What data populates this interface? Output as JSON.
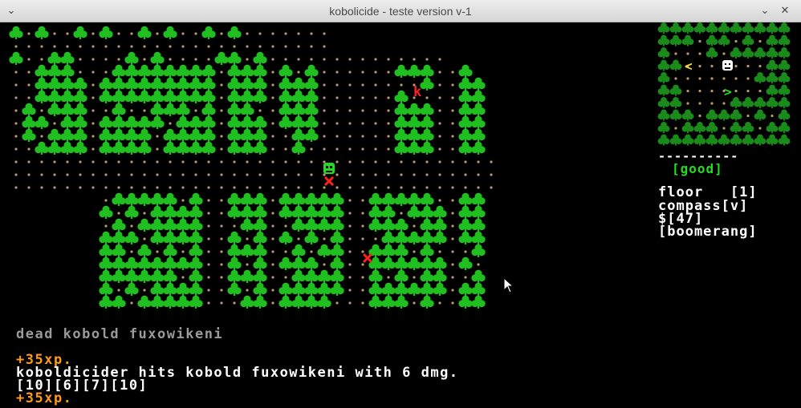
{
  "window": {
    "title": "kobolicide - teste version v-1",
    "menu_glyph": "⌄",
    "min_glyph": "⌄",
    "close_glyph": "✕"
  },
  "hud": {
    "divider": "----------",
    "status": "[good]",
    "floor": "floor   [1]",
    "compass": "compass[v]",
    "money": "$[47]",
    "weapon": "[boomerang]"
  },
  "log": {
    "line1": "dead kobold fuxowikeni",
    "line2": "+35xp.",
    "line3": "koboldicider hits kobold fuxowikeni with 6 dmg.",
    "line4": "[10][6][7][10]",
    "line5": "+35xp."
  },
  "colors": {
    "tree": "#1fbf1f",
    "dirt": "#b89a6e",
    "enemy": "#ff2020",
    "player": "#20dd20",
    "xp": "#ff9a1a",
    "minimap_tree": "#1a8a1a"
  },
  "icons": [
    "menu-icon",
    "minimize-icon",
    "close-icon",
    "player-icon",
    "kobold-icon",
    "x-mark-icon",
    "boomerang-icon",
    "mouse-cursor-icon"
  ]
}
